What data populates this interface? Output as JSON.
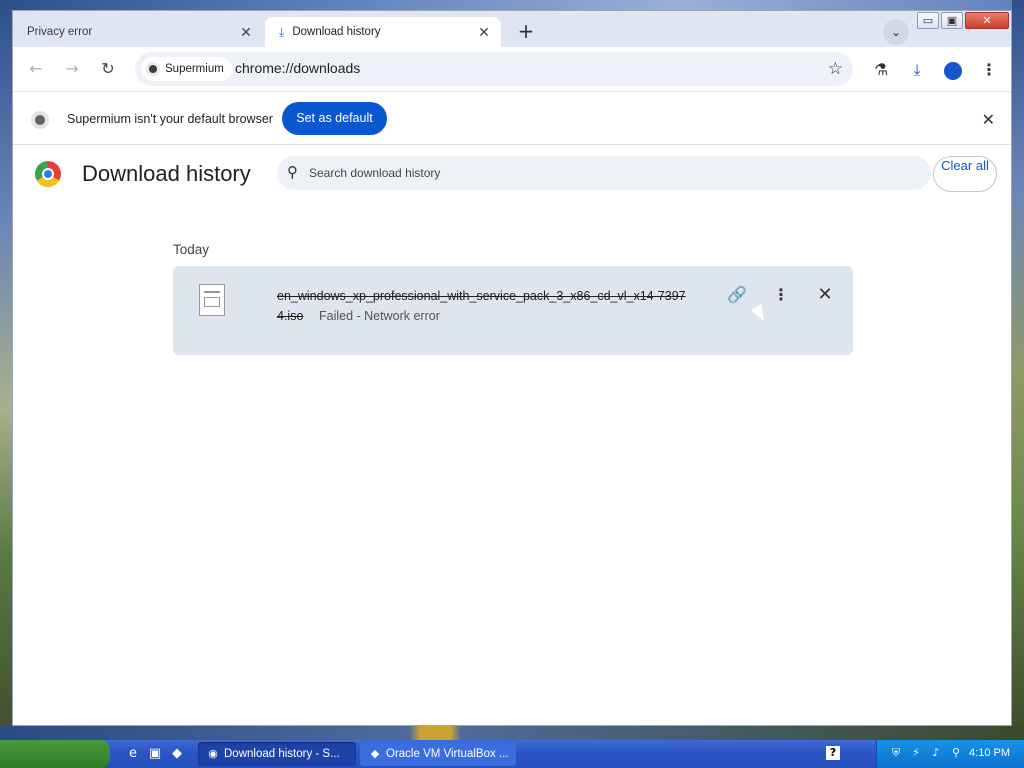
{
  "tabs": {
    "inactive_label": "Privacy error",
    "active_label": "Download history",
    "new_tab": "+",
    "tab_search": "⌄"
  },
  "window_controls": {
    "minimize": "▭",
    "maximize": "▣",
    "close": "✕"
  },
  "toolbar": {
    "back": "←",
    "forward": "→",
    "reload": "↻",
    "site_chip": "Supermium",
    "url": "chrome://downloads",
    "star": "☆",
    "labs": "⚗",
    "download": "⤓",
    "menu": "⋮"
  },
  "infobar": {
    "message": "Supermium isn't your default browser",
    "button": "Set as default",
    "close": "✕"
  },
  "page": {
    "title": "Download history",
    "search_placeholder": "Search download history",
    "search_icon": "⚲",
    "clear_all": "Clear all",
    "day_label": "Today"
  },
  "download": {
    "filename": "en_windows_xp_professional_with_service_pack_3_x86_cd_vl_x14-7397 4.iso",
    "status": "Failed - Network error",
    "link_icon": "🔗",
    "more_icon": "⋮",
    "remove_icon": "✕"
  },
  "taskbar": {
    "task1": "Download history - S...",
    "task2": "Oracle VM VirtualBox ...",
    "help": "?",
    "clock": "4:10 PM"
  },
  "icons": {
    "tab_download": "download-icon",
    "site": "supermium-icon",
    "file": "file-icon"
  },
  "colors": {
    "accent": "#0b57d0",
    "card_bg": "#dfe5ee",
    "taskbar": "#2650be"
  }
}
